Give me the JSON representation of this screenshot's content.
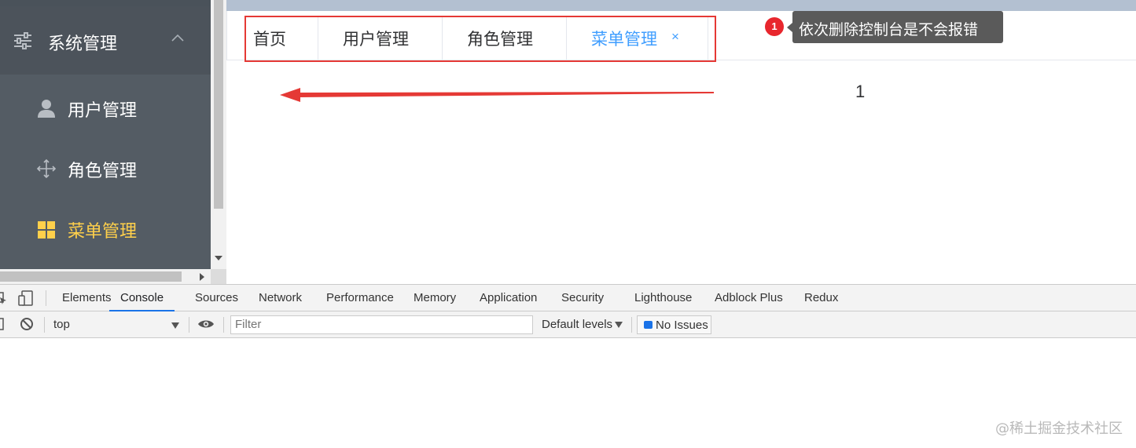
{
  "sidebar": {
    "submenu_title": "系统管理",
    "items": [
      {
        "label": "用户管理",
        "icon": "user-icon"
      },
      {
        "label": "角色管理",
        "icon": "move-icon"
      },
      {
        "label": "菜单管理",
        "icon": "menu-grid-icon",
        "active": true
      }
    ],
    "colors": {
      "bg": "#545c64",
      "active_text": "#ffd04b"
    }
  },
  "tabs": [
    {
      "label": "首页"
    },
    {
      "label": "用户管理"
    },
    {
      "label": "角色管理"
    },
    {
      "label": "菜单管理",
      "active": true,
      "close": "×"
    }
  ],
  "annotation": {
    "badge": "1",
    "tooltip": "依次删除控制台是不会报错"
  },
  "content": {
    "value": "1"
  },
  "devtools": {
    "tabs": [
      "Elements",
      "Console",
      "Sources",
      "Network",
      "Performance",
      "Memory",
      "Application",
      "Security",
      "Lighthouse",
      "Adblock Plus",
      "Redux"
    ],
    "active_tab": "Console",
    "context": "top",
    "filter_placeholder": "Filter",
    "levels": "Default levels",
    "issues": "No Issues"
  },
  "watermark": "@稀土掘金技术社区",
  "colors": {
    "accent": "#409eff",
    "header": "#b3c0d1",
    "highlight_red": "#e53935"
  }
}
